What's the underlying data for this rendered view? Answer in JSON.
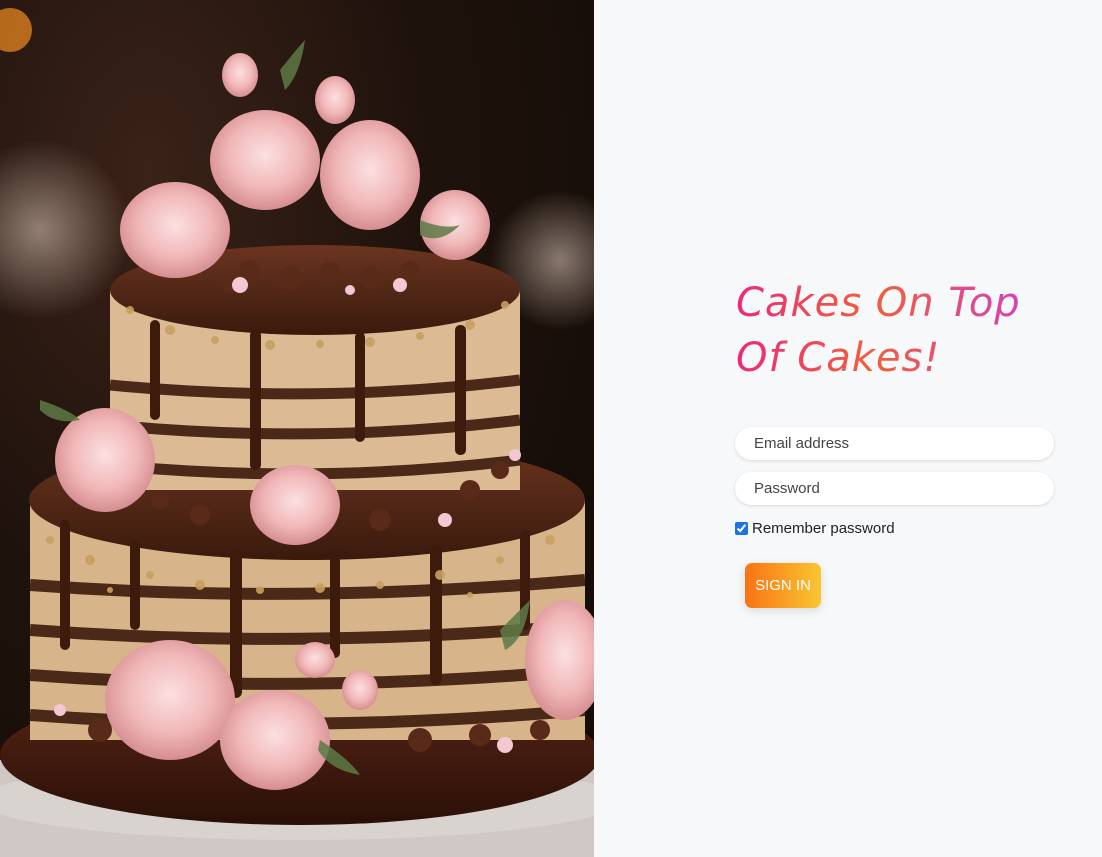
{
  "hero": {
    "alt": "Two-tier chocolate cake with pink roses"
  },
  "login": {
    "title": "Cakes On Top Of Cakes!",
    "email_placeholder": "Email address",
    "password_placeholder": "Password",
    "remember_label": "Remember password",
    "remember_checked": true,
    "signin_label": "SIGN IN"
  },
  "colors": {
    "title_gradient": [
      "#ec2a7a",
      "#f0603a",
      "#d43cc4"
    ],
    "button_gradient": [
      "#f97316",
      "#f9c631"
    ],
    "panel_bg": "#f7f8fa"
  }
}
